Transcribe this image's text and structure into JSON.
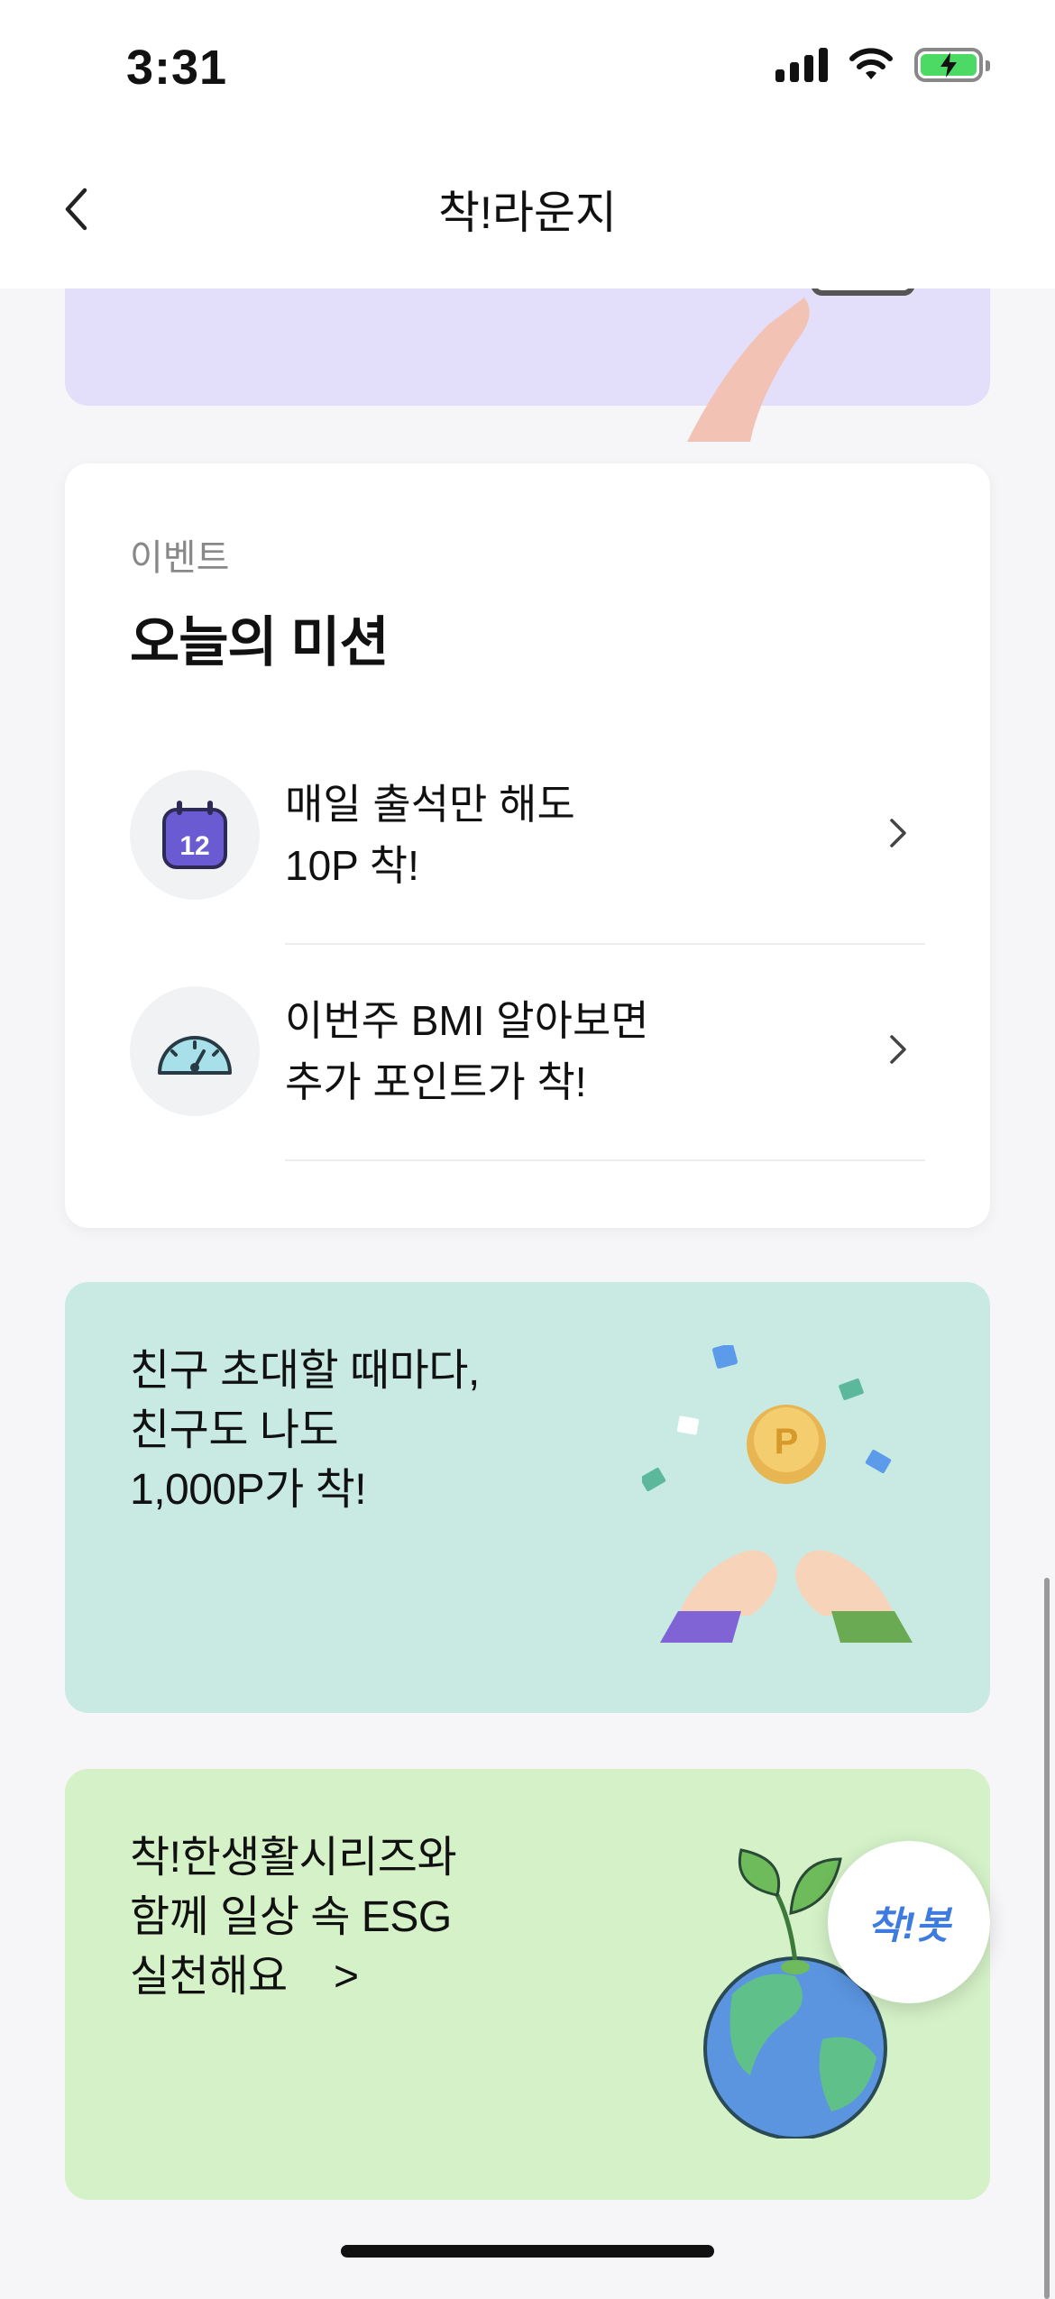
{
  "status_bar": {
    "time": "3:31",
    "battery_color": "#4cd964",
    "icons": [
      "signal-icon",
      "wifi-icon",
      "battery-charging-icon"
    ]
  },
  "nav": {
    "title": "착!라운지",
    "back_icon": "chevron-left-icon"
  },
  "mission_card": {
    "label": "이벤트",
    "title": "오늘의 미션",
    "items": [
      {
        "line1": "매일 출석만 해도",
        "line2": "10P 착!",
        "icon": "calendar-icon",
        "icon_number": "12"
      },
      {
        "line1": "이번주 BMI 알아보면",
        "line2": "추가 포인트가 착!",
        "icon": "gauge-icon"
      }
    ]
  },
  "invite_card": {
    "line1": "친구 초대할 때마다,",
    "line2": "친구도 나도",
    "line3": "1,000P가 착!",
    "coin_letter": "P",
    "background": "#c8eae3"
  },
  "esg_card": {
    "line1": "착!한생활시리즈와",
    "line2": "함께 일상 속 ESG",
    "line3": "실천해요",
    "arrow": ">",
    "background": "#d4f1c7"
  },
  "fab": {
    "label": "착!봇",
    "color": "#3d7be0"
  },
  "accent_banner": {
    "background": "#e3dffb"
  }
}
